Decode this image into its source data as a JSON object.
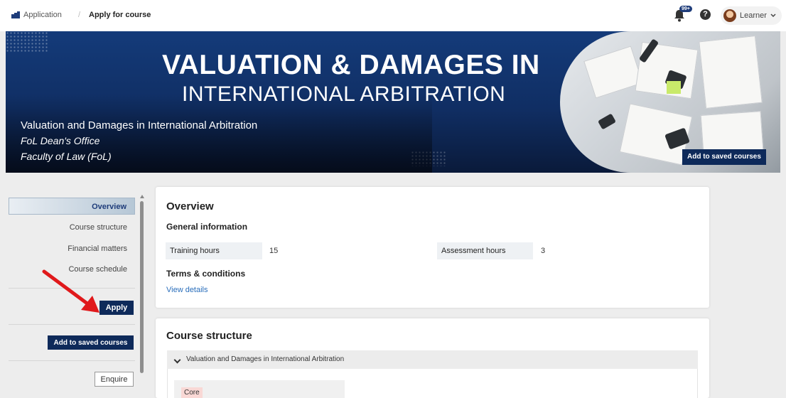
{
  "breadcrumb": {
    "app": "Application",
    "current": "Apply for course"
  },
  "header": {
    "notification_badge": "99+",
    "help_icon": "?",
    "user_label": "Learner"
  },
  "banner": {
    "title_line1": "VALUATION & DAMAGES IN",
    "title_line2": "INTERNATIONAL ARBITRATION",
    "course_name": "Valuation and Damages in International Arbitration",
    "office": "FoL Dean's Office",
    "faculty": "Faculty  of Law (FoL)",
    "save_label": "Add to saved courses"
  },
  "sidebar": {
    "items": [
      {
        "label": "Overview",
        "active": true
      },
      {
        "label": "Course structure"
      },
      {
        "label": "Financial matters"
      },
      {
        "label": "Course schedule"
      }
    ],
    "apply_label": "Apply",
    "save_label": "Add to saved courses",
    "enquire_label": "Enquire"
  },
  "overview": {
    "title": "Overview",
    "general_info_title": "General information",
    "training_hours_label": "Training hours",
    "training_hours_value": "15",
    "assessment_hours_label": "Assessment hours",
    "assessment_hours_value": "3",
    "terms_title": "Terms & conditions",
    "view_details_label": "View details"
  },
  "course_structure": {
    "title": "Course structure",
    "module_title": "Valuation and Damages in International Arbitration",
    "core_label": "Core"
  },
  "colors": {
    "navy": "#0e2a5a",
    "banner_blue": "#143b7a",
    "link": "#2a6ebb",
    "annotation_arrow": "#e0191b",
    "core_tag": "#f9d8d5"
  },
  "icons": [
    "app-logo-icon",
    "bell-icon",
    "help-icon",
    "avatar",
    "chevron-down-icon",
    "annotation-arrow"
  ]
}
